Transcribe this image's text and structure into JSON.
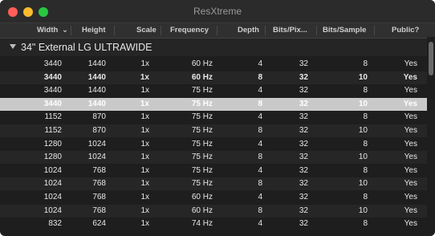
{
  "window": {
    "title": "ResXtreme"
  },
  "columns": [
    {
      "key": "width",
      "label": "Width"
    },
    {
      "key": "height",
      "label": "Height"
    },
    {
      "key": "scale",
      "label": "Scale"
    },
    {
      "key": "frequency",
      "label": "Frequency"
    },
    {
      "key": "depth",
      "label": "Depth"
    },
    {
      "key": "bits_pixel",
      "label": "Bits/Pix..."
    },
    {
      "key": "bits_sample",
      "label": "Bits/Sample"
    },
    {
      "key": "public",
      "label": "Public?"
    }
  ],
  "sort_indicator": "⌄",
  "group": {
    "title": "34\" External LG ULTRAWIDE"
  },
  "rows": [
    {
      "width": "3440",
      "height": "1440",
      "scale": "1x",
      "frequency": "60 Hz",
      "depth": "4",
      "bits_pixel": "32",
      "bits_sample": "8",
      "public": "Yes"
    },
    {
      "width": "3440",
      "height": "1440",
      "scale": "1x",
      "frequency": "60 Hz",
      "depth": "8",
      "bits_pixel": "32",
      "bits_sample": "10",
      "public": "Yes"
    },
    {
      "width": "3440",
      "height": "1440",
      "scale": "1x",
      "frequency": "75 Hz",
      "depth": "4",
      "bits_pixel": "32",
      "bits_sample": "8",
      "public": "Yes"
    },
    {
      "width": "3440",
      "height": "1440",
      "scale": "1x",
      "frequency": "75 Hz",
      "depth": "8",
      "bits_pixel": "32",
      "bits_sample": "10",
      "public": "Yes"
    },
    {
      "width": "1152",
      "height": "870",
      "scale": "1x",
      "frequency": "75 Hz",
      "depth": "4",
      "bits_pixel": "32",
      "bits_sample": "8",
      "public": "Yes"
    },
    {
      "width": "1152",
      "height": "870",
      "scale": "1x",
      "frequency": "75 Hz",
      "depth": "8",
      "bits_pixel": "32",
      "bits_sample": "10",
      "public": "Yes"
    },
    {
      "width": "1280",
      "height": "1024",
      "scale": "1x",
      "frequency": "75 Hz",
      "depth": "4",
      "bits_pixel": "32",
      "bits_sample": "8",
      "public": "Yes"
    },
    {
      "width": "1280",
      "height": "1024",
      "scale": "1x",
      "frequency": "75 Hz",
      "depth": "8",
      "bits_pixel": "32",
      "bits_sample": "10",
      "public": "Yes"
    },
    {
      "width": "1024",
      "height": "768",
      "scale": "1x",
      "frequency": "75 Hz",
      "depth": "4",
      "bits_pixel": "32",
      "bits_sample": "8",
      "public": "Yes"
    },
    {
      "width": "1024",
      "height": "768",
      "scale": "1x",
      "frequency": "75 Hz",
      "depth": "8",
      "bits_pixel": "32",
      "bits_sample": "10",
      "public": "Yes"
    },
    {
      "width": "1024",
      "height": "768",
      "scale": "1x",
      "frequency": "60 Hz",
      "depth": "4",
      "bits_pixel": "32",
      "bits_sample": "8",
      "public": "Yes"
    },
    {
      "width": "1024",
      "height": "768",
      "scale": "1x",
      "frequency": "60 Hz",
      "depth": "8",
      "bits_pixel": "32",
      "bits_sample": "10",
      "public": "Yes"
    },
    {
      "width": "832",
      "height": "624",
      "scale": "1x",
      "frequency": "74 Hz",
      "depth": "4",
      "bits_pixel": "32",
      "bits_sample": "8",
      "public": "Yes"
    }
  ],
  "selected_row_index": 3,
  "bold_row_index": 1,
  "colors": {
    "window_bg": "#1e1e1e",
    "selection": "#c9c9c9",
    "close": "#ff5f57",
    "minimize": "#febc2e",
    "zoom": "#28c840"
  }
}
